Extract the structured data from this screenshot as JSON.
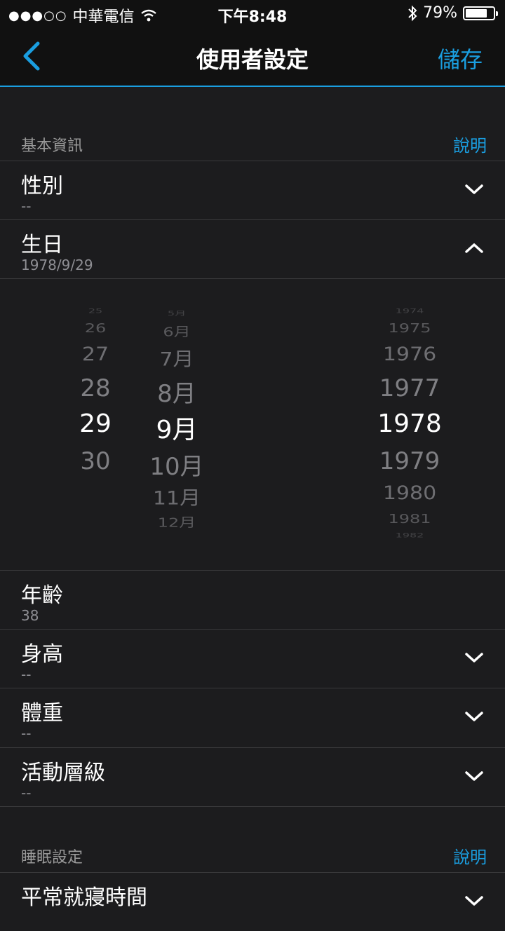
{
  "status_bar": {
    "signal": "●●●○○",
    "carrier": "中華電信",
    "time": "下午8:48",
    "battery_percent": "79%",
    "battery_level": 0.79
  },
  "nav": {
    "title": "使用者設定",
    "save": "儲存"
  },
  "sections": {
    "basic": {
      "label": "基本資訊",
      "help": "說明"
    },
    "sleep": {
      "label": "睡眠設定",
      "help": "說明"
    }
  },
  "rows": {
    "gender": {
      "title": "性別",
      "value": "--"
    },
    "birthday": {
      "title": "生日",
      "value": "1978/9/29"
    },
    "age": {
      "title": "年齡",
      "value": "38"
    },
    "height": {
      "title": "身高",
      "value": "--"
    },
    "weight": {
      "title": "體重",
      "value": "--"
    },
    "activity": {
      "title": "活動層級",
      "value": "--"
    },
    "bedtime": {
      "title": "平常就寢時間"
    }
  },
  "picker": {
    "day": [
      "25",
      "26",
      "27",
      "28",
      "29",
      "30"
    ],
    "month": [
      "5月",
      "6月",
      "7月",
      "8月",
      "9月",
      "10月",
      "11月",
      "12月"
    ],
    "year": [
      "1974",
      "1975",
      "1976",
      "1977",
      "1978",
      "1979",
      "1980",
      "1981",
      "1982"
    ]
  },
  "colors": {
    "accent": "#1a9ee0",
    "background": "#1c1c1e",
    "bar": "#111111"
  }
}
